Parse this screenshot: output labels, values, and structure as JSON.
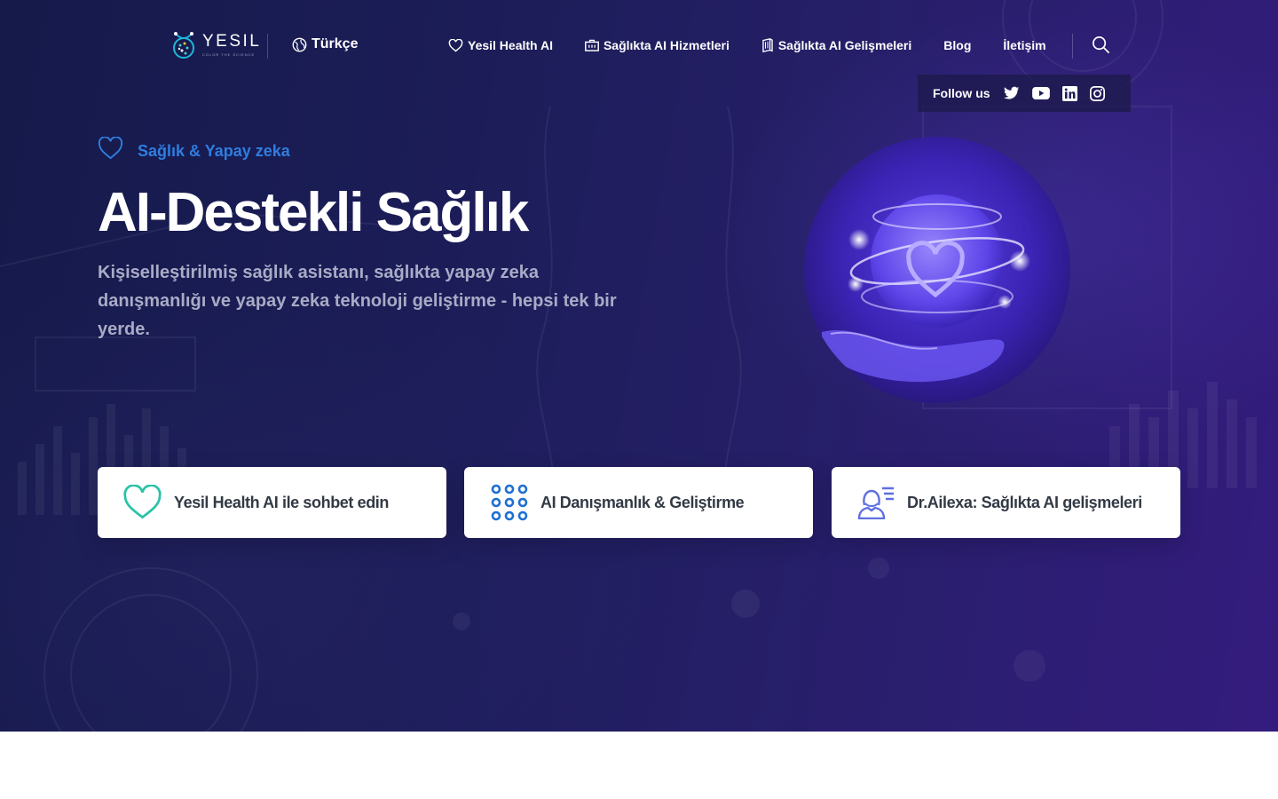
{
  "header": {
    "logo": {
      "name": "YESIL",
      "tagline": "COLOR THE SCIENCE"
    },
    "language": "Türkçe",
    "nav": [
      {
        "label": "Yesil Health AI",
        "icon": "heart-icon"
      },
      {
        "label": "Sağlıkta AI Hizmetleri",
        "icon": "briefcase-icon"
      },
      {
        "label": "Sağlıkta AI Gelişmeleri",
        "icon": "book-icon"
      },
      {
        "label": "Blog"
      },
      {
        "label": "İletişim"
      }
    ],
    "search_icon": "search-icon"
  },
  "social": {
    "label": "Follow us",
    "links": [
      "twitter-icon",
      "youtube-icon",
      "linkedin-icon",
      "instagram-icon"
    ]
  },
  "hero": {
    "eyebrow": "Sağlık & Yapay zeka",
    "title": "AI-Destekli Sağlık",
    "description": "Kişiselleştirilmiş sağlık asistanı, sağlıkta yapay zeka danışmanlığı ve yapay zeka teknoloji geliştirme - hepsi tek bir yerde."
  },
  "cards": [
    {
      "label": "Yesil Health AI ile sohbet edin",
      "icon": "heart-icon",
      "color": "#2bc2a8"
    },
    {
      "label": "AI Danışmanlık & Geliştirme",
      "icon": "dots-grid-icon",
      "color": "#1f6fd1"
    },
    {
      "label": "Dr.Ailexa: Sağlıkta AI gelişmeleri",
      "icon": "assistant-icon",
      "color": "#5f6fe0"
    }
  ],
  "colors": {
    "background": "#1c1d58",
    "accent": "#2f7ddf",
    "text_muted": "#a9abc6"
  }
}
